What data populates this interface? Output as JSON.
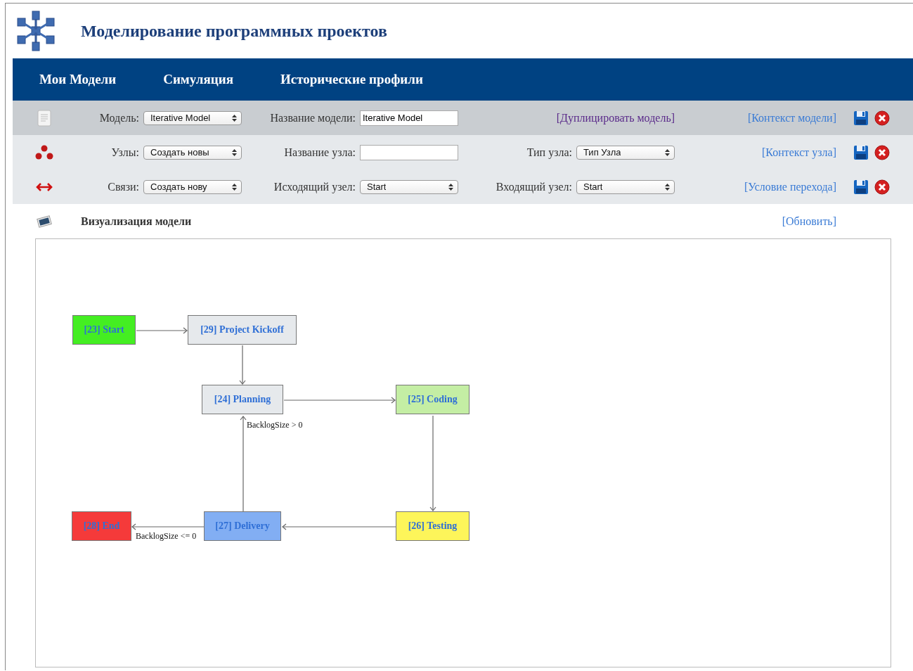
{
  "header": {
    "title": "Моделирование программных проектов"
  },
  "nav": [
    {
      "label": "Мои Модели"
    },
    {
      "label": "Симуляция"
    },
    {
      "label": "Исторические профили"
    }
  ],
  "rows": [
    {
      "kind": "model",
      "label": "Модель:",
      "select": "Iterative Model",
      "field_label": "Название модели:",
      "field": {
        "kind": "input",
        "value": "Iterative Model"
      },
      "extra": {
        "kind": "link",
        "text": "[Дуплицировать модель]"
      },
      "link": "[Контекст модели]"
    },
    {
      "kind": "node",
      "label": "Узлы:",
      "select": "Создать новы",
      "field_label": "Название узла:",
      "field": {
        "kind": "input"
      },
      "extra": {
        "kind": "select",
        "label": "Тип узла:",
        "text": "Тип Узла"
      },
      "link": "[Контекст узла]"
    },
    {
      "kind": "link",
      "label": "Связи:",
      "select": "Создать нову",
      "field_label": "Исходящий узел:",
      "field": {
        "kind": "select",
        "value": "Start"
      },
      "extra": {
        "kind": "select",
        "label": "Входящий узел:",
        "text": "Start"
      },
      "link": "[Условие перехода]"
    }
  ],
  "visualization": {
    "title": "Визуализация модели",
    "refresh_link": "[Обновить]",
    "nodes": [
      {
        "label": "[23] Start",
        "color": "#44ee22"
      },
      {
        "label": "[29] Project Kickoff",
        "color": "#e6e9ec"
      },
      {
        "label": "[24] Planning",
        "color": "#e6e9ec"
      },
      {
        "label": "[25] Coding",
        "color": "#c4eea4"
      },
      {
        "label": "[28] End",
        "color": "#f53a3a"
      },
      {
        "label": "[27] Delivery",
        "color": "#82aef3"
      },
      {
        "label": "[26] Testing",
        "color": "#fdf55a"
      }
    ],
    "conditions": [
      "BacklogSize > 0",
      "BacklogSize <= 0"
    ]
  }
}
